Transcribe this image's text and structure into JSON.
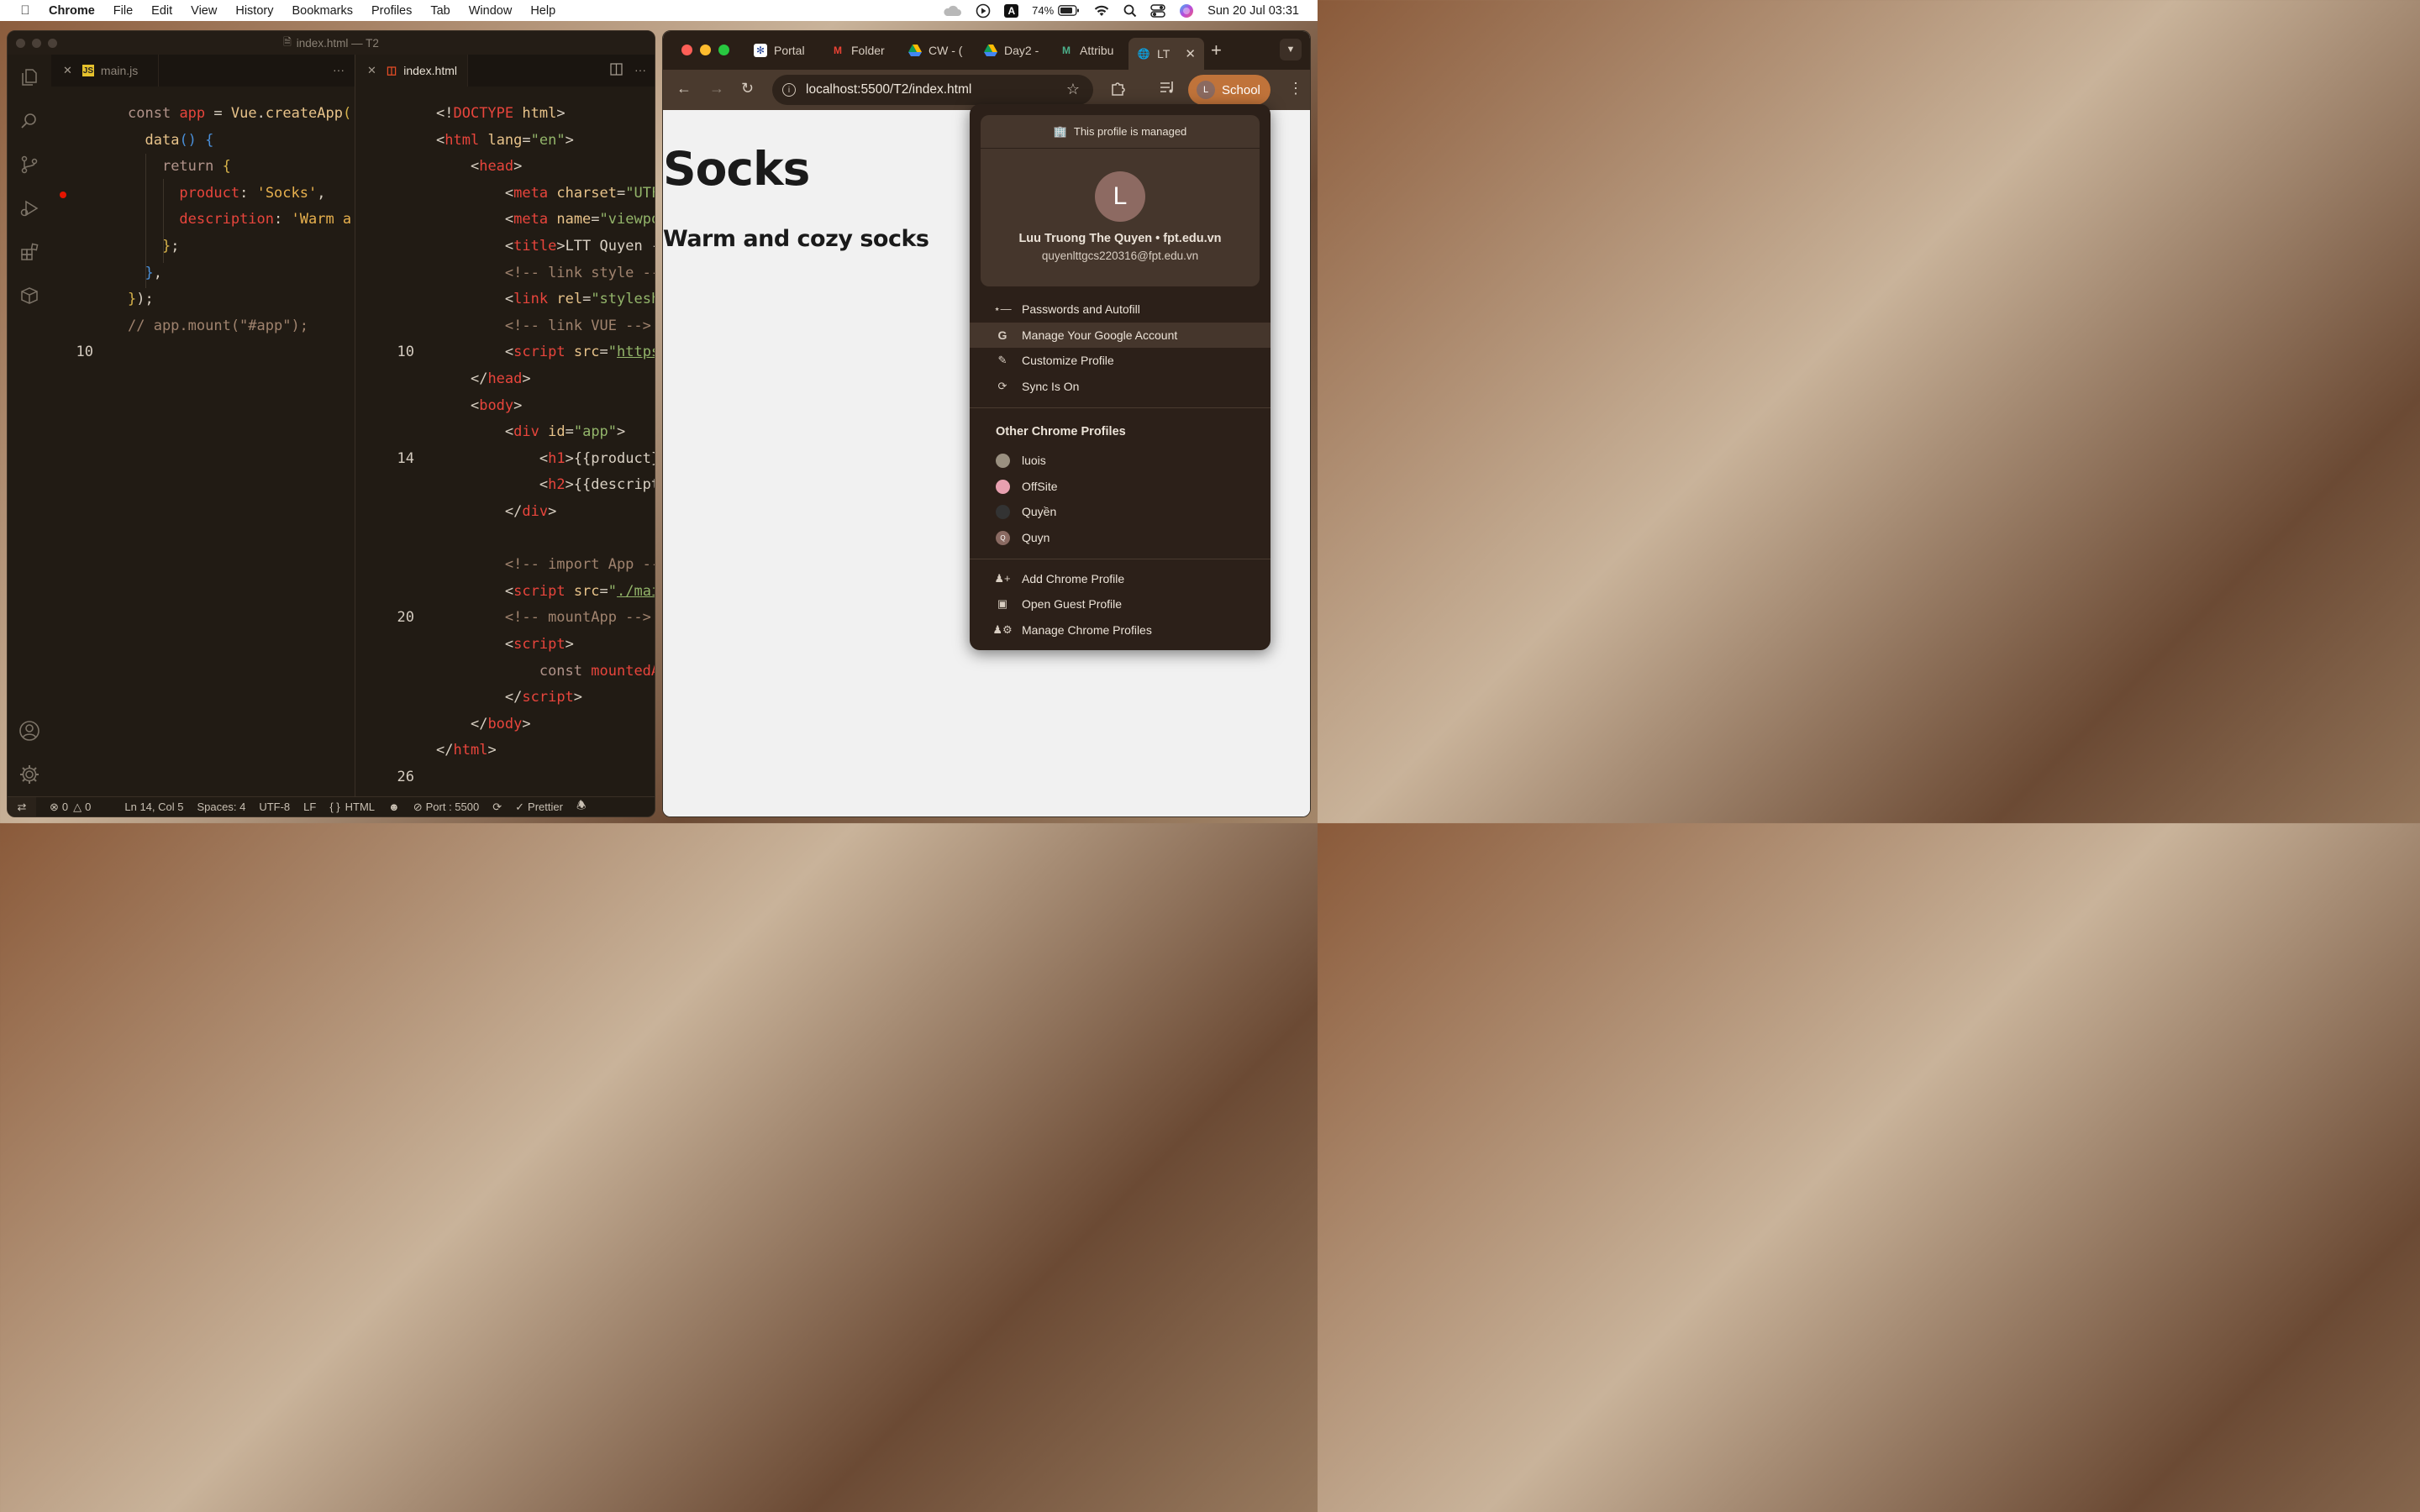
{
  "menubar": {
    "app": "Chrome",
    "items": [
      "File",
      "Edit",
      "View",
      "History",
      "Bookmarks",
      "Profiles",
      "Tab",
      "Window",
      "Help"
    ],
    "input_source": "A",
    "battery": "74%",
    "datetime": "Sun 20 Jul  03:31"
  },
  "vscode": {
    "title": "index.html — T2",
    "left_tab": "main.js",
    "right_tab": "index.html",
    "left_code": [
      {
        "n": "",
        "html": "<span class='kw'>const</span> <span class='id'>app</span> <span class='punc'>=</span> <span class='fn'>Vue</span><span class='punc'>.</span><span class='fn'>createApp</span><span class='br2'>(</span>"
      },
      {
        "n": "",
        "html": "  <span class='fn'>data</span><span class='br'>()</span> <span class='br'>{</span>"
      },
      {
        "n": "",
        "html": "    <span class='kw'>return</span> <span class='br2'>{</span>"
      },
      {
        "n": "",
        "html": "      <span class='id'>product</span><span class='punc'>:</span> <span class='str'>'Socks'</span><span class='punc'>,</span>"
      },
      {
        "n": "",
        "html": "      <span class='id'>description</span><span class='punc'>:</span> <span class='str'>'Warm a</span>"
      },
      {
        "n": "",
        "html": "    <span class='br2'>}</span><span class='punc'>;</span>"
      },
      {
        "n": "",
        "html": "  <span class='br'>}</span><span class='punc'>,</span>"
      },
      {
        "n": "",
        "html": "<span class='br2'>}</span><span class='punc'>);</span>"
      },
      {
        "n": "",
        "html": "<span class='cm'>// app.mount(\"#app\");</span>"
      },
      {
        "n": "10",
        "html": ""
      }
    ],
    "right_code": [
      {
        "n": "",
        "html": "<span class='pl'>&lt;!</span><span class='tg'>DOCTYPE</span> <span class='at'>html</span><span class='pl'>&gt;</span>"
      },
      {
        "n": "",
        "html": "<span class='pl'>&lt;</span><span class='tg'>html</span> <span class='at'>lang</span><span class='pl'>=</span><span class='sv'>\"en\"</span><span class='pl'>&gt;</span>"
      },
      {
        "n": "",
        "html": "    <span class='pl'>&lt;</span><span class='tg'>head</span><span class='pl'>&gt;</span>"
      },
      {
        "n": "",
        "html": "        <span class='pl'>&lt;</span><span class='tg'>meta</span> <span class='at'>charset</span><span class='pl'>=</span><span class='sv'>\"UTF</span>"
      },
      {
        "n": "",
        "html": "        <span class='pl'>&lt;</span><span class='tg'>meta</span> <span class='at'>name</span><span class='pl'>=</span><span class='sv'>\"viewpo</span>"
      },
      {
        "n": "",
        "html": "        <span class='pl'>&lt;</span><span class='tg'>title</span><span class='pl'>&gt;LTT Quyen -</span>"
      },
      {
        "n": "",
        "html": "        <span class='cm'>&lt;!-- link style --</span>"
      },
      {
        "n": "",
        "html": "        <span class='pl'>&lt;</span><span class='tg'>link</span> <span class='at'>rel</span><span class='pl'>=</span><span class='sv'>\"stylesh</span>"
      },
      {
        "n": "",
        "html": "        <span class='cm'>&lt;!-- link VUE --&gt;</span>"
      },
      {
        "n": "10",
        "html": "        <span class='pl'>&lt;</span><span class='tg'>script</span> <span class='at'>src</span><span class='pl'>=</span><span class='sv'>\"</span><span class='url'>https</span>"
      },
      {
        "n": "",
        "html": "    <span class='pl'>&lt;/</span><span class='tg'>head</span><span class='pl'>&gt;</span>"
      },
      {
        "n": "",
        "html": "    <span class='pl'>&lt;</span><span class='tg'>body</span><span class='pl'>&gt;</span>"
      },
      {
        "n": "",
        "html": "        <span class='pl'>&lt;</span><span class='tg'>div</span> <span class='at'>id</span><span class='pl'>=</span><span class='sv'>\"app\"</span><span class='pl'>&gt;</span>"
      },
      {
        "n": "14",
        "html": "            <span class='pl'>&lt;</span><span class='tg'>h1</span><span class='pl'>&gt;{{product}</span>"
      },
      {
        "n": "",
        "html": "            <span class='pl'>&lt;</span><span class='tg'>h2</span><span class='pl'>&gt;{{descript</span>"
      },
      {
        "n": "",
        "html": "        <span class='pl'>&lt;/</span><span class='tg'>div</span><span class='pl'>&gt;</span>"
      },
      {
        "n": "",
        "html": ""
      },
      {
        "n": "",
        "html": "        <span class='cm'>&lt;!-- import App --</span>"
      },
      {
        "n": "",
        "html": "        <span class='pl'>&lt;</span><span class='tg'>script</span> <span class='at'>src</span><span class='pl'>=</span><span class='sv'>\"</span><span class='url'>./mai</span>"
      },
      {
        "n": "20",
        "html": "        <span class='cm'>&lt;!-- mountApp --&gt;</span>"
      },
      {
        "n": "",
        "html": "        <span class='pl'>&lt;</span><span class='tg'>script</span><span class='pl'>&gt;</span>"
      },
      {
        "n": "",
        "html": "            <span class='kw'>const</span> <span class='id'>mountedA</span>"
      },
      {
        "n": "",
        "html": "        <span class='pl'>&lt;/</span><span class='tg'>script</span><span class='pl'>&gt;</span>"
      },
      {
        "n": "",
        "html": "    <span class='pl'>&lt;/</span><span class='tg'>body</span><span class='pl'>&gt;</span>"
      },
      {
        "n": "",
        "html": "<span class='pl'>&lt;/</span><span class='tg'>html</span><span class='pl'>&gt;</span>"
      },
      {
        "n": "26",
        "html": ""
      }
    ],
    "status": {
      "errors": "0",
      "warnings": "0",
      "position": "Ln 14, Col 5",
      "spaces": "Spaces: 4",
      "encoding": "UTF-8",
      "eol": "LF",
      "language": "HTML",
      "port": "Port : 5500",
      "formatter": "Prettier"
    }
  },
  "chrome": {
    "tabs": [
      "Portal",
      "Folder",
      "CW - (",
      "Day2 -",
      "Attribu",
      "LT"
    ],
    "url": "localhost:5500/T2/index.html",
    "profile_button": "School",
    "profile_initial": "L",
    "page": {
      "h1": "Socks",
      "h2": "Warm and cozy socks"
    },
    "profile_menu": {
      "managed": "This profile is managed",
      "initial": "L",
      "name": "Luu Truong The Quyen • fpt.edu.vn",
      "email": "quyenlttgcs220316@fpt.edu.vn",
      "items": [
        "Passwords and Autofill",
        "Manage Your Google Account",
        "Customize Profile",
        "Sync Is On"
      ],
      "other_header": "Other Chrome Profiles",
      "profiles": [
        "luois",
        "OffSite",
        "Quyền",
        "Quyn"
      ],
      "profile_q_initial": "Q",
      "bottom_items": [
        "Add Chrome Profile",
        "Open Guest Profile",
        "Manage Chrome Profiles"
      ]
    }
  }
}
